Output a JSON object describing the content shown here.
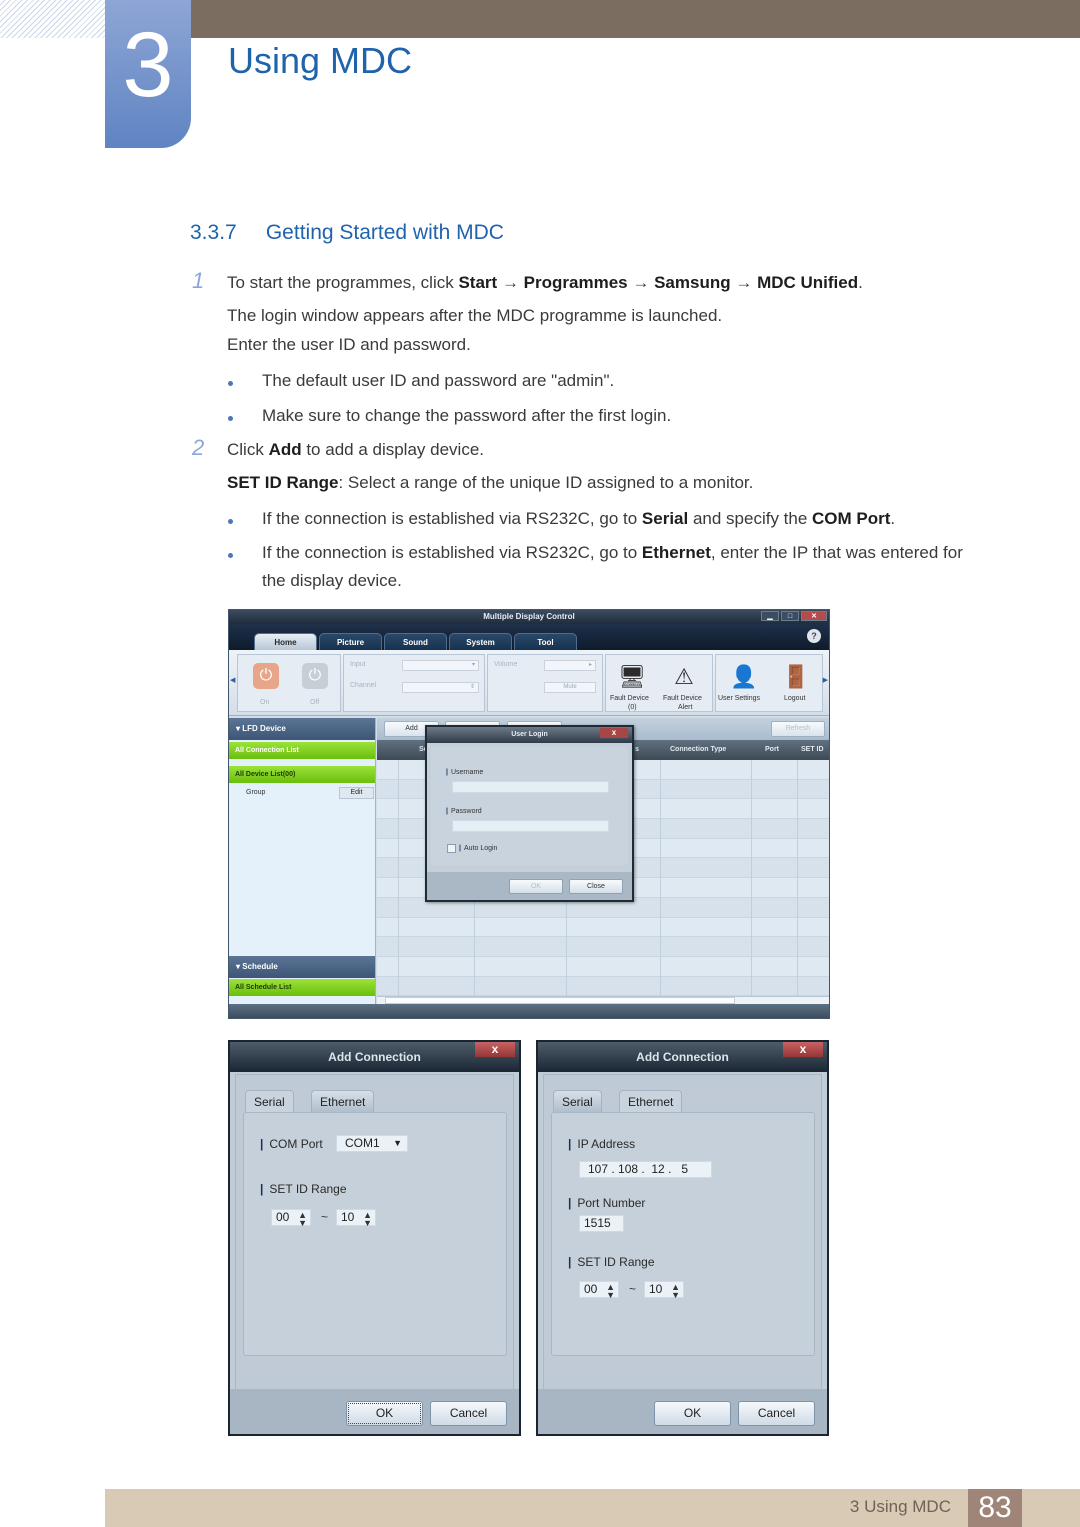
{
  "chapter": {
    "number": "3",
    "title": "Using MDC"
  },
  "section": {
    "number": "3.3.7",
    "title": "Getting Started with MDC"
  },
  "steps": [
    {
      "number": "1",
      "intro_prefix": "To start the programmes, click ",
      "path": [
        "Start",
        "Programmes",
        "Samsung",
        "MDC Unified"
      ],
      "arrow": "→",
      "lines": [
        "The login window appears after the MDC programme is launched.",
        "Enter the user ID and password."
      ],
      "bullets": [
        "The default user ID and password are \"admin\".",
        "Make sure to change the password after the first login."
      ]
    },
    {
      "number": "2",
      "intro_prefix": "Click ",
      "intro_bold": "Add",
      "intro_suffix": " to add a display device.",
      "setid_bold": "SET ID Range",
      "setid_text": ": Select a range of the unique ID assigned to a monitor.",
      "bullet1": {
        "prefix": "If the connection is established via RS232C, go to ",
        "bold1": "Serial",
        "mid": " and specify the ",
        "bold2": "COM Port",
        "suffix": "."
      },
      "bullet2": {
        "prefix": "If the connection is established via RS232C, go to ",
        "bold1": "Ethernet",
        "suffix": ", enter the IP that was entered for",
        "line2": "the display device."
      }
    }
  ],
  "mdc_window": {
    "title": "Multiple Display Control",
    "tabs": [
      "Home",
      "Picture",
      "Sound",
      "System",
      "Tool"
    ],
    "active_tab": "Home",
    "help": "?",
    "ribbon": {
      "on": "On",
      "off": "Off",
      "input": "Input",
      "channel": "Channel",
      "volume": "Volume",
      "mute": "Mute",
      "fault_device": "Fault Device",
      "fault_device_count": "(0)",
      "fault_device_alert": "Fault Device",
      "fault_device_alert_2": "Alert",
      "user_settings": "User Settings",
      "logout": "Logout"
    },
    "sidebar": {
      "lfd_header": "LFD Device",
      "all_connection_list": "All Connection List",
      "all_device_list": "All Device List(00)",
      "group": "Group",
      "edit": "Edit",
      "schedule_header": "Schedule",
      "all_schedule_list": "All Schedule List"
    },
    "toolbar": {
      "add": "Add",
      "refresh": "Refresh"
    },
    "grid_columns": [
      "Se",
      "s",
      "Connection Type",
      "Port",
      "SET ID"
    ]
  },
  "login_dialog": {
    "title": "User Login",
    "close_x": "x",
    "username_label": "Username",
    "username_value": "",
    "password_label": "Password",
    "password_value": "",
    "auto_login": "Auto Login",
    "auto_login_checked": false,
    "ok": "OK",
    "close": "Close"
  },
  "add_connection_serial": {
    "title": "Add Connection",
    "close_x": "x",
    "tabs": [
      "Serial",
      "Ethernet"
    ],
    "active_tab": "Serial",
    "com_port_label": "COM Port",
    "com_port_value": "COM1",
    "set_id_label": "SET ID Range",
    "set_id_from": "00",
    "set_id_to": "10",
    "tilde": "~",
    "ok": "OK",
    "cancel": "Cancel"
  },
  "add_connection_ethernet": {
    "title": "Add Connection",
    "close_x": "x",
    "tabs": [
      "Serial",
      "Ethernet"
    ],
    "active_tab": "Ethernet",
    "ip_label": "IP Address",
    "ip_value": "107 . 108 .  12 .   5",
    "port_label": "Port Number",
    "port_value": "1515",
    "set_id_label": "SET ID Range",
    "set_id_from": "00",
    "set_id_to": "10",
    "tilde": "~",
    "ok": "OK",
    "cancel": "Cancel"
  },
  "footer": {
    "chapter_label": "3 Using MDC",
    "page_number": "83"
  }
}
